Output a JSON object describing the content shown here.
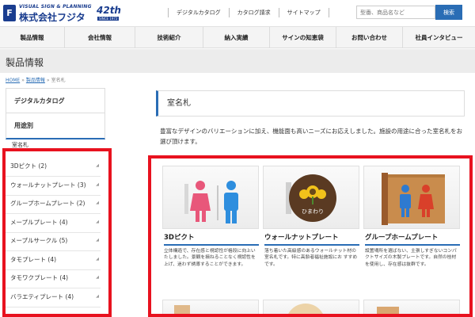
{
  "header": {
    "logo_tagline": "VISUAL SIGN & PLANNING",
    "logo_name": "株式会社フジタ",
    "anniversary": "42th",
    "anniversary_since": "SINCE 1972",
    "util_links": [
      "デジタルカタログ",
      "カタログ請求",
      "サイトマップ"
    ],
    "search_placeholder": "型番、商品名など",
    "search_button": "検索"
  },
  "nav": {
    "items": [
      "製品情報",
      "会社情報",
      "技術紹介",
      "納入実績",
      "サインの知恵袋",
      "お問い合わせ",
      "社員インタビュー"
    ]
  },
  "page": {
    "title": "製品情報",
    "breadcrumb": [
      "HOME",
      "製品情報",
      "室名札"
    ]
  },
  "sidebar": {
    "heads": [
      "デジタルカタログ",
      "用途別"
    ],
    "sub": "室名札",
    "items": [
      {
        "label": "3Dピクト",
        "count": "(2)"
      },
      {
        "label": "ウォールナットプレート",
        "count": "(3)"
      },
      {
        "label": "グループホームプレート",
        "count": "(2)"
      },
      {
        "label": "メープルプレート",
        "count": "(4)"
      },
      {
        "label": "メープルサークル",
        "count": "(5)"
      },
      {
        "label": "タモプレート",
        "count": "(4)"
      },
      {
        "label": "タモワクプレート",
        "count": "(4)"
      },
      {
        "label": "バラエティプレート",
        "count": "(4)"
      }
    ]
  },
  "main": {
    "heading": "室名札",
    "description": "豊富なデザインのバリエーションに加え、機能面も高いニーズにお応えしました。施設の用途に合った室名札をお選び頂けます。",
    "cards": [
      {
        "title": "3Dピクト",
        "desc": "立体構造で、存在感と視認性が格段に向上いたしました。景観を損ねることなく視認性を上げ、迷わず誘導することができます。"
      },
      {
        "title": "ウォールナットプレート",
        "sign_text": "ひまわり",
        "desc": "落ち着いた高級感のあるウォールナット材の室名札です。特に高齢者福祉施設にお すすめです。"
      },
      {
        "title": "グループホームプレート",
        "desc": "設置場所を選ばない、主張しすぎないコンパクトサイズの木製プレートです。自然の桂材を使用し、存在感は抜群です。"
      }
    ]
  },
  "colors": {
    "brand": "#1a3d8f",
    "accent": "#2a6db5",
    "highlight": "#e8121f"
  }
}
